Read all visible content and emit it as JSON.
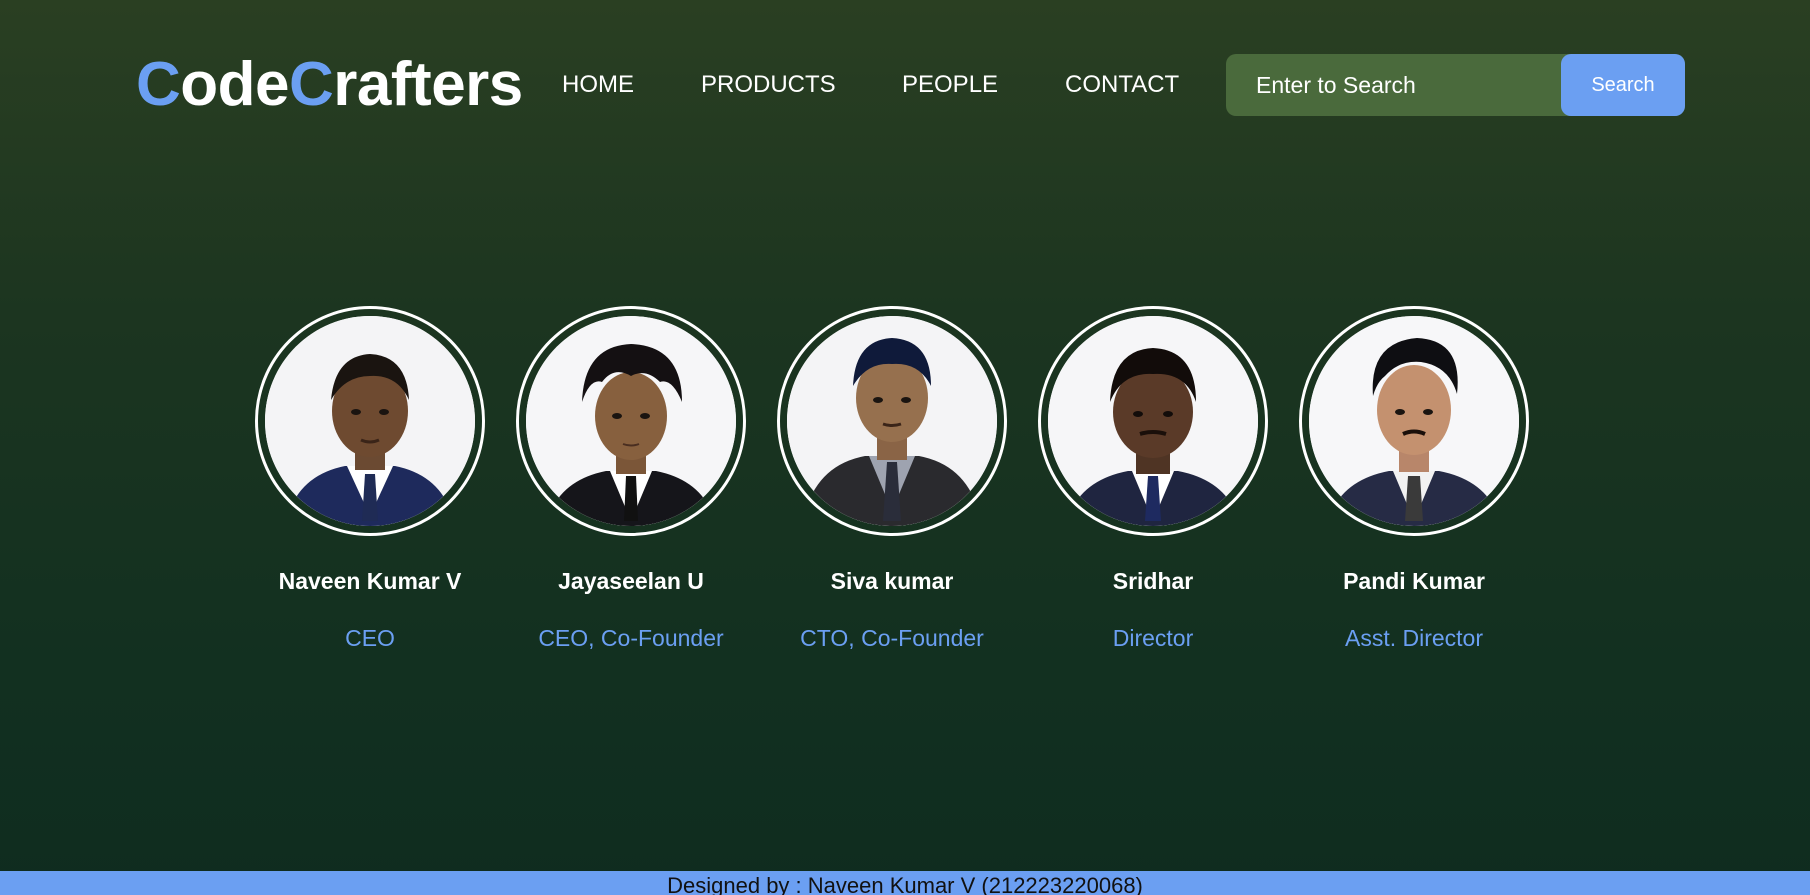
{
  "logo": {
    "letter1": "C",
    "part1": "ode",
    "letter2": "C",
    "part2": "rafters"
  },
  "nav": {
    "items": [
      {
        "label": "HOME"
      },
      {
        "label": "PRODUCTS"
      },
      {
        "label": "PEOPLE"
      },
      {
        "label": "CONTACT"
      }
    ]
  },
  "search": {
    "placeholder": "Enter to Search",
    "button_label": "Search"
  },
  "people": [
    {
      "name": "Naveen Kumar V",
      "role": "CEO",
      "suit_color": "#1e2a5c",
      "tie_color": "#1f2b55",
      "hair": "short"
    },
    {
      "name": "Jayaseelan U",
      "role": "CEO, Co-Founder",
      "suit_color": "#15151a",
      "tie_color": "#111111",
      "hair": "curly"
    },
    {
      "name": "Siva kumar",
      "role": "CTO, Co-Founder",
      "suit_color": "#2a2a2e",
      "tie_color": "#2a2d3a",
      "hair": "short"
    },
    {
      "name": "Sridhar",
      "role": "Director",
      "suit_color": "#1f2540",
      "tie_color": "#1e2a60",
      "hair": "short"
    },
    {
      "name": "Pandi Kumar",
      "role": "Asst. Director",
      "suit_color": "#262b45",
      "tie_color": "#3a3a3a",
      "hair": "quiff"
    }
  ],
  "footer": {
    "text": "Designed by : Naveen Kumar V (212223220068)"
  },
  "colors": {
    "accent": "#6b9ff2",
    "search_bg": "#4a6a3c",
    "page_bg_top": "#2a3f22",
    "page_bg_bottom": "#0f2c1f"
  }
}
